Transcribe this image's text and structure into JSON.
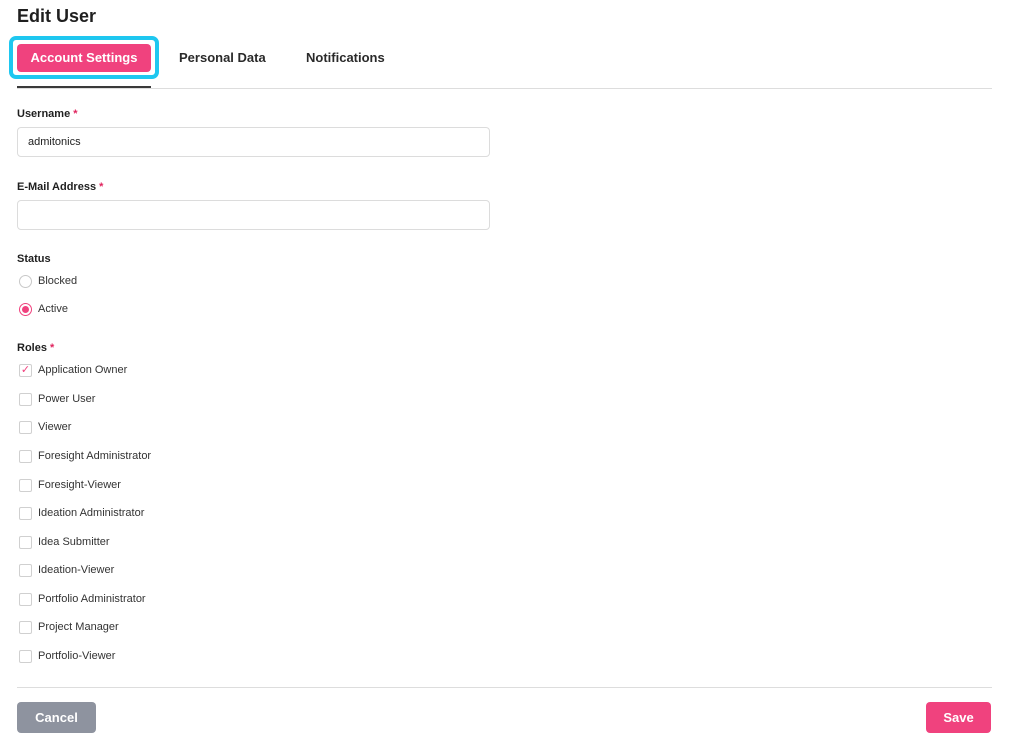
{
  "page": {
    "title": "Edit User"
  },
  "tabs": [
    {
      "label": "Account Settings",
      "active": true
    },
    {
      "label": "Personal Data",
      "active": false
    },
    {
      "label": "Notifications",
      "active": false
    }
  ],
  "form": {
    "required_mark": "*",
    "username": {
      "label": "Username",
      "value": "admitonics",
      "placeholder": ""
    },
    "email": {
      "label": "E-Mail Address",
      "value": "",
      "placeholder": ""
    },
    "status": {
      "label": "Status",
      "options": [
        {
          "label": "Blocked",
          "checked": false
        },
        {
          "label": "Active",
          "checked": true
        }
      ]
    },
    "roles": {
      "label": "Roles",
      "options": [
        {
          "label": "Application Owner",
          "checked": true
        },
        {
          "label": "Power User",
          "checked": false
        },
        {
          "label": "Viewer",
          "checked": false
        },
        {
          "label": "Foresight Administrator",
          "checked": false
        },
        {
          "label": "Foresight-Viewer",
          "checked": false
        },
        {
          "label": "Ideation Administrator",
          "checked": false
        },
        {
          "label": "Idea Submitter",
          "checked": false
        },
        {
          "label": "Ideation-Viewer",
          "checked": false
        },
        {
          "label": "Portfolio Administrator",
          "checked": false
        },
        {
          "label": "Project Manager",
          "checked": false
        },
        {
          "label": "Portfolio-Viewer",
          "checked": false
        }
      ]
    }
  },
  "actions": {
    "cancel_label": "Cancel",
    "save_label": "Save"
  },
  "colors": {
    "accent": "#f0427e",
    "highlight": "#1ec7f0",
    "cancel": "#8e939f"
  },
  "icons": {
    "check": "check-icon"
  }
}
